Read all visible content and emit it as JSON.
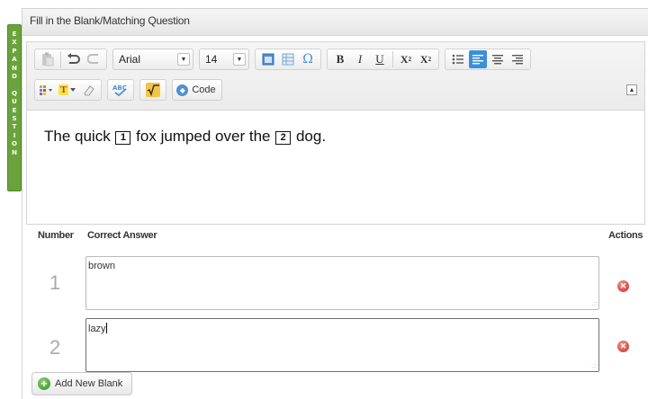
{
  "expand_tab": {
    "letters": [
      "E",
      "X",
      "P",
      "A",
      "N",
      "D",
      " ",
      "Q",
      "U",
      "E",
      "S",
      "T",
      "I",
      "O",
      "N"
    ]
  },
  "panel": {
    "title": "Fill in the Blank/Matching Question"
  },
  "toolbar": {
    "font_family": "Arial",
    "font_size": "14",
    "code_label": "Code",
    "icons": {
      "paste": "paste-icon",
      "undo": "undo-icon",
      "redo": "redo-icon",
      "table": "table-icon",
      "table2": "table-grid-icon",
      "omega": "special-char-icon",
      "bold": "B",
      "italic": "I",
      "underline": "U",
      "subscript": "X",
      "superscript": "X",
      "sub_mark": "2",
      "sup_mark": "2",
      "bullet_list": "bullet-list-icon",
      "align_left": "align-left-icon",
      "align_center": "align-center-icon",
      "align_right": "align-right-icon",
      "font_color": "T",
      "colors_grid": "color-grid-icon",
      "eraser": "eraser-icon",
      "spellcheck": "spellcheck-icon",
      "math": "math-root-icon"
    },
    "active_color": "#3b8fd9"
  },
  "editor": {
    "text_before": "The quick",
    "blank1": "1",
    "text_middle": "fox jumped over the",
    "blank2": "2",
    "text_after": "dog."
  },
  "answers": {
    "col_number": "Number",
    "col_answer": "Correct Answer",
    "col_actions": "Actions",
    "rows": [
      {
        "number": "1",
        "answer": "brown"
      },
      {
        "number": "2",
        "answer": "lazy"
      }
    ]
  },
  "add_button": {
    "label": "Add New Blank"
  },
  "colors": {
    "expand_tab_bg": "#6aa33b",
    "delete_red": "#d9534f",
    "add_green": "#4ea43a"
  }
}
